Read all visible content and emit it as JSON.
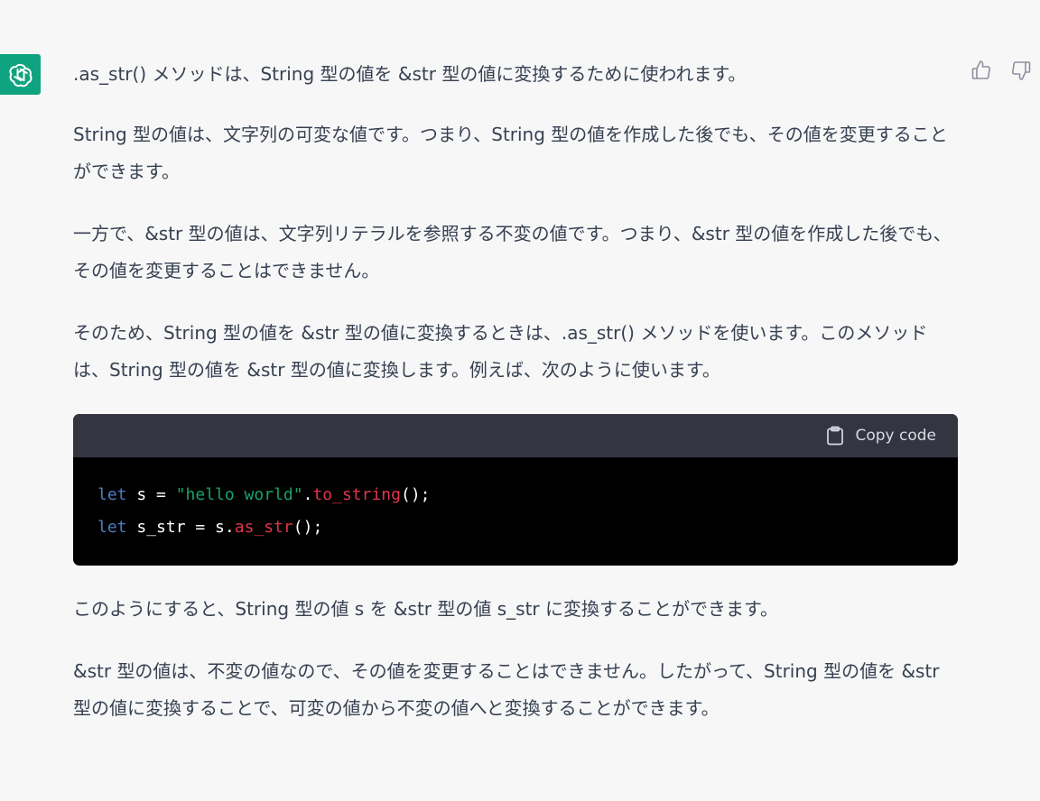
{
  "paragraphs": [
    ".as_str() メソッドは、String 型の値を &str 型の値に変換するために使われます。",
    "String 型の値は、文字列の可変な値です。つまり、String 型の値を作成した後でも、その値を変更することができます。",
    "一方で、&str 型の値は、文字列リテラルを参照する不変の値です。つまり、&str 型の値を作成した後でも、その値を変更することはできません。",
    "そのため、String 型の値を &str 型の値に変換するときは、.as_str() メソッドを使います。このメソッドは、String 型の値を &str 型の値に変換します。例えば、次のように使います。",
    "このようにすると、String 型の値 s を &str 型の値 s_str に変換することができます。",
    "&str 型の値は、不変の値なので、その値を変更することはできません。したがって、String 型の値を &str 型の値に変換することで、可変の値から不変の値へと変換することができます。"
  ],
  "code": {
    "copy_label": "Copy code",
    "line1": {
      "kw": "let",
      "a": " s = ",
      "str": "\"hello world\"",
      "dot": ".",
      "fn": "to_string",
      "end": "();"
    },
    "line2": {
      "kw": "let",
      "a": " s_str = s.",
      "fn": "as_str",
      "end": "();"
    }
  },
  "icons": {
    "avatar": "openai-logo-icon",
    "thumbs_up": "thumbs-up-icon",
    "thumbs_down": "thumbs-down-icon",
    "copy": "clipboard-icon"
  },
  "colors": {
    "background": "#f7f7f8",
    "avatar_bg": "#10a37f",
    "code_header": "#343541",
    "code_bg": "#000000",
    "keyword": "#4a7fc1",
    "string": "#16a36b",
    "function": "#e0354a"
  }
}
